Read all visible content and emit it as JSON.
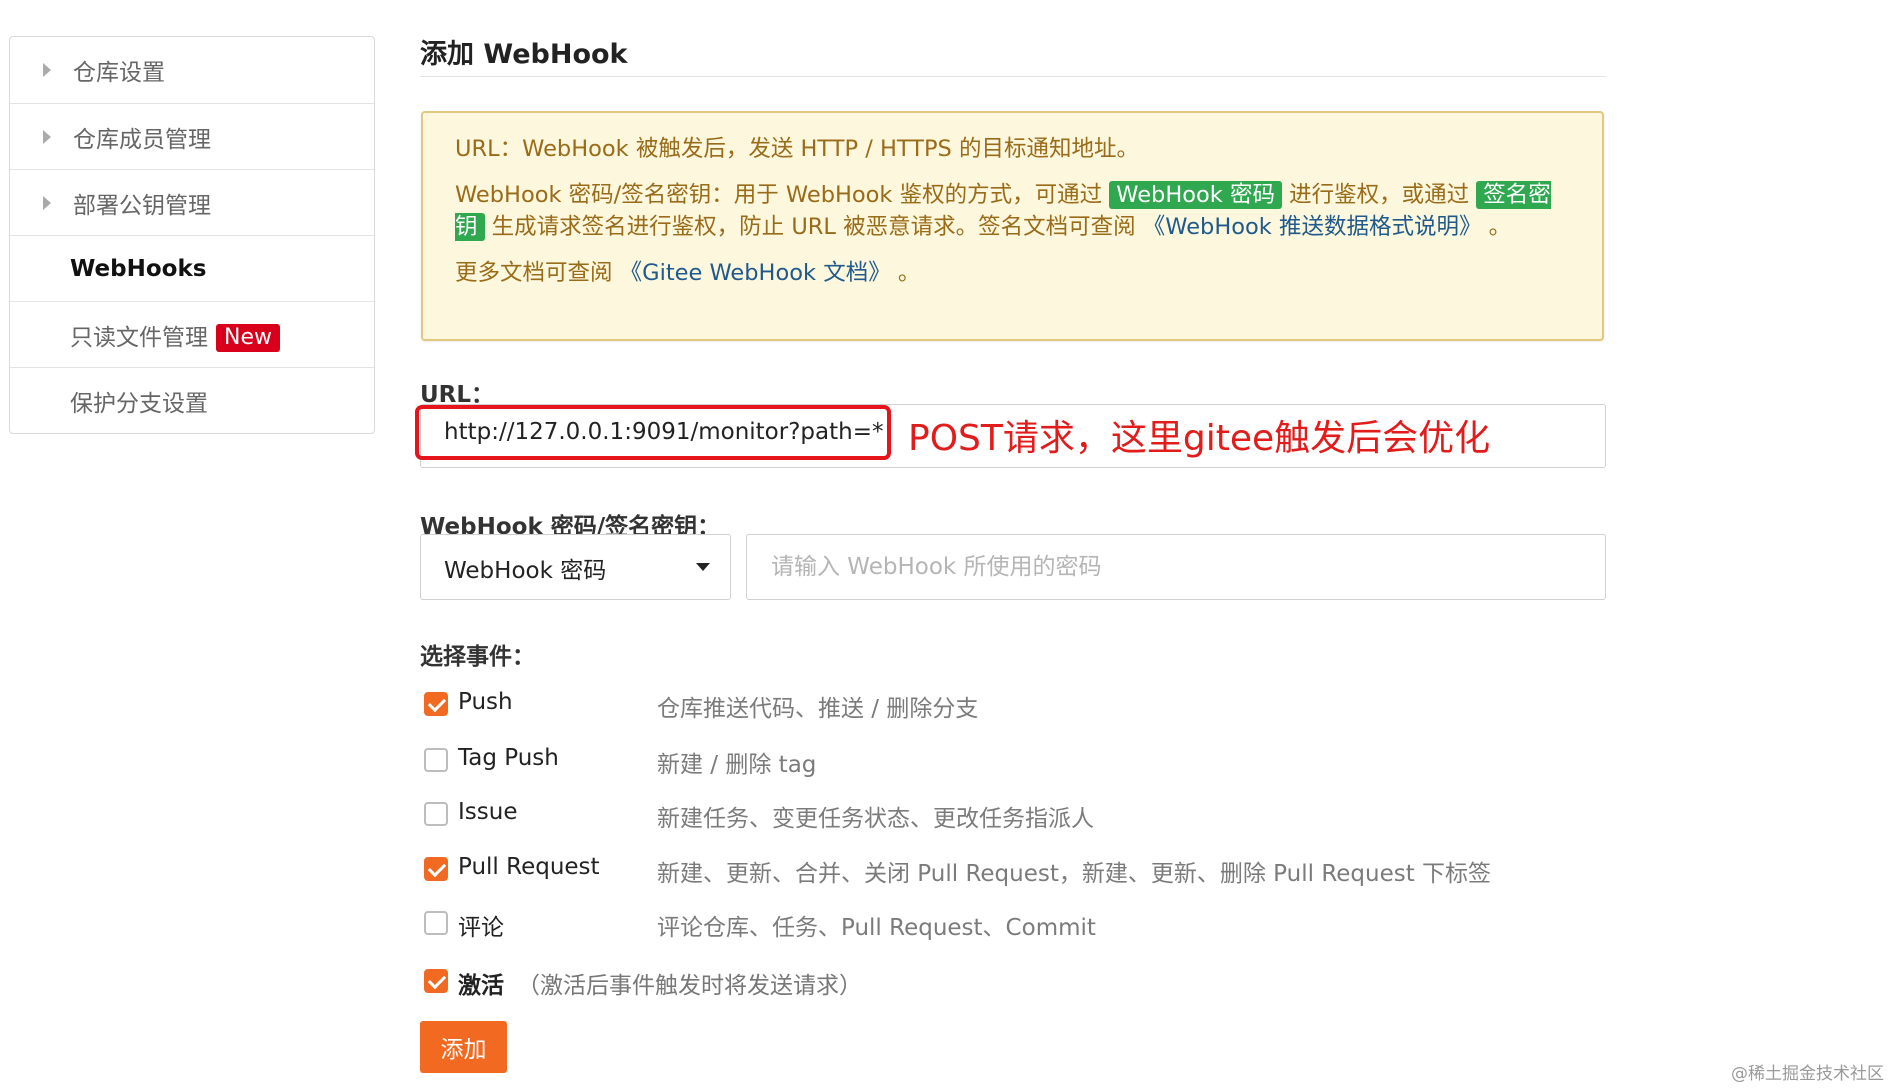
{
  "sidebar": {
    "items": [
      {
        "label": "仓库设置"
      },
      {
        "label": "仓库成员管理"
      },
      {
        "label": "部署公钥管理"
      },
      {
        "label": "WebHooks"
      },
      {
        "label": "只读文件管理",
        "badge": "New"
      },
      {
        "label": "保护分支设置"
      }
    ]
  },
  "page": {
    "title": "添加 WebHook"
  },
  "notice": {
    "p1": "URL：WebHook 被触发后，发送 HTTP / HTTPS 的目标通知地址。",
    "p2_a": "WebHook 密码/签名密钥：用于 WebHook 鉴权的方式，可通过 ",
    "p2_hl1": "WebHook 密码",
    "p2_b": " 进行鉴权，或通过 ",
    "p2_hl2": "签名密钥",
    "p2_c": " 生成请求签名进行鉴权，防止 URL 被恶意请求。签名文档可查阅 ",
    "p2_link": "《WebHook 推送数据格式说明》",
    "p2_d": " 。",
    "p3_a": "更多文档可查阅 ",
    "p3_link": "《Gitee WebHook 文档》",
    "p3_b": " 。"
  },
  "url": {
    "label": "URL：",
    "value": "http://127.0.0.1:9091/monitor?path=*",
    "annotation": "POST请求，这里gitee触发后会优化"
  },
  "secret": {
    "label": "WebHook 密码/签名密钥：",
    "type_selected": "WebHook 密码",
    "placeholder": "请输入 WebHook 所使用的密码"
  },
  "events": {
    "label": "选择事件：",
    "items": [
      {
        "name": "Push",
        "desc": "仓库推送代码、推送 / 删除分支",
        "checked": true
      },
      {
        "name": "Tag Push",
        "desc": "新建 / 删除 tag",
        "checked": false
      },
      {
        "name": "Issue",
        "desc": "新建任务、变更任务状态、更改任务指派人",
        "checked": false
      },
      {
        "name": "Pull Request",
        "desc": "新建、更新、合并、关闭 Pull Request，新建、更新、删除 Pull Request 下标签",
        "checked": true
      },
      {
        "name": "评论",
        "desc": "评论仓库、任务、Pull Request、Commit",
        "checked": false
      }
    ]
  },
  "activate": {
    "label": "激活",
    "hint": "（激活后事件触发时将发送请求）",
    "checked": true
  },
  "button": {
    "add_label": "添加"
  },
  "watermark": "@稀土掘金技术社区",
  "colors": {
    "accent": "#f26a22",
    "annotation": "#e21b1b",
    "notice_bg": "#fcf7dd",
    "badge": "#d9001b",
    "highlight_green": "#2fa84f"
  }
}
